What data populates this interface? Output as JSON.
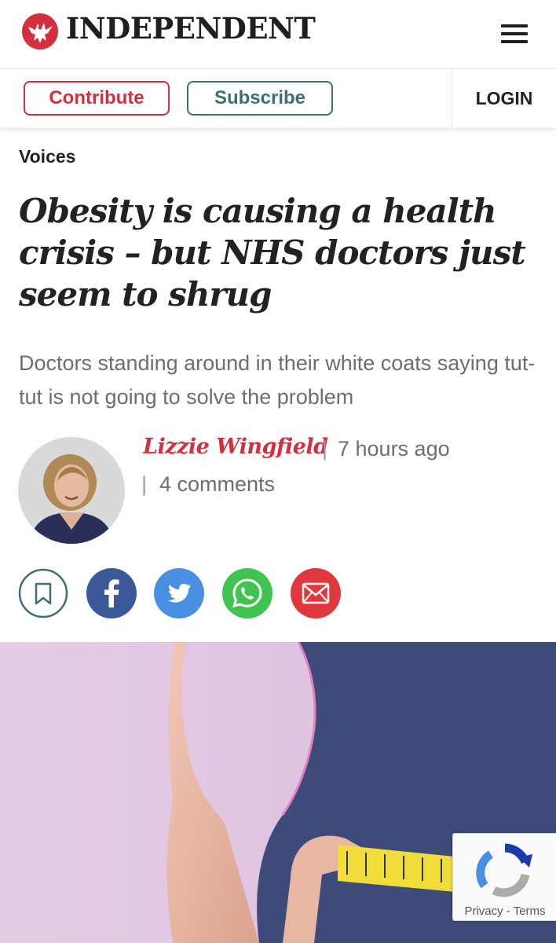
{
  "header": {
    "logo_text": "INDEPENDENT",
    "logo_icon": "eagle-icon",
    "menu_icon": "hamburger-icon"
  },
  "actions": {
    "contribute_label": "Contribute",
    "subscribe_label": "Subscribe",
    "login_label": "LOGIN"
  },
  "article": {
    "section": "Voices",
    "headline": "Obesity is causing a health crisis – but NHS doctors just seem to shrug",
    "standfirst": "Doctors standing around in their white coats saying tut-tut is not going to solve the problem",
    "author": "Lizzie Wingfield",
    "separator": "|",
    "timestamp": "7 hours ago",
    "comments": "4 comments"
  },
  "share_icons": [
    "bookmark-icon",
    "facebook-icon",
    "twitter-icon",
    "whatsapp-icon",
    "email-icon"
  ],
  "recaptcha": {
    "privacy": "Privacy",
    "dash": "-",
    "terms": "Terms"
  },
  "colors": {
    "brand_red": "#d32f3e",
    "subscribe_teal": "#3f6f70",
    "facebook": "#3b5998",
    "twitter": "#4a90e2",
    "whatsapp": "#40c351",
    "email": "#e0383e"
  }
}
